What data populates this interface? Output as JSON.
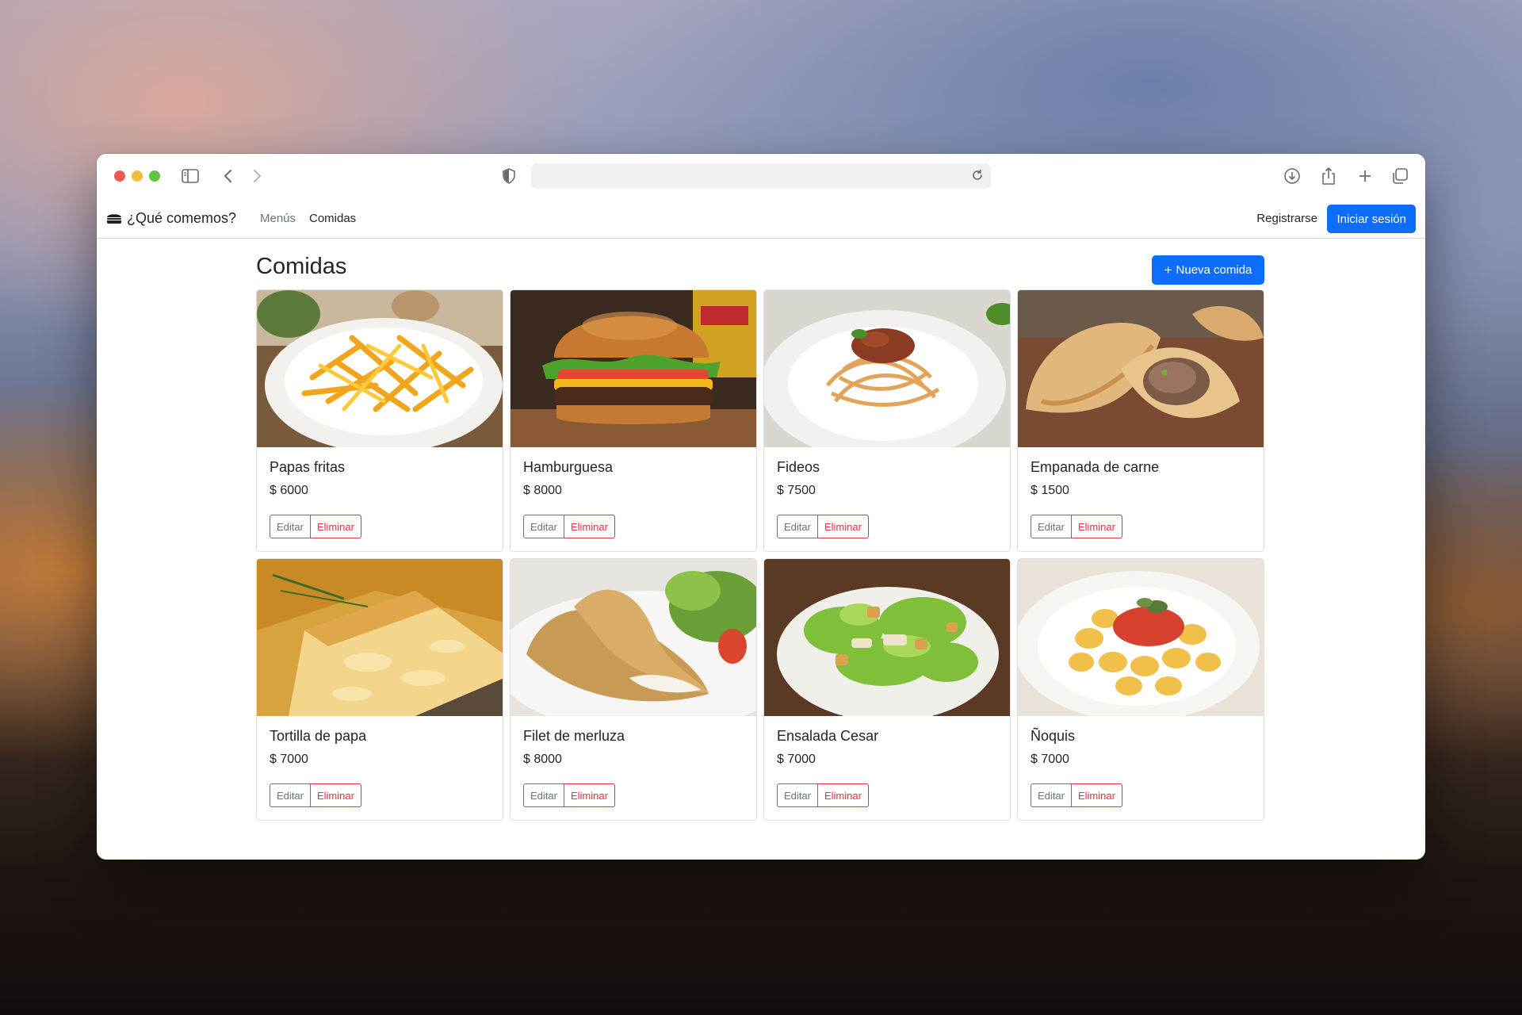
{
  "app": {
    "brand": "¿Qué comemos?",
    "nav": {
      "menus": "Menús",
      "comidas": "Comidas"
    },
    "register": "Registrarse",
    "login": "Iniciar sesión"
  },
  "page": {
    "title": "Comidas",
    "new_button": "Nueva comida"
  },
  "buttons": {
    "edit": "Editar",
    "delete": "Eliminar"
  },
  "foods": [
    {
      "name": "Papas fritas",
      "price": "$ 6000",
      "image": "french-fries-photo"
    },
    {
      "name": "Hamburguesa",
      "price": "$ 8000",
      "image": "hamburger-photo"
    },
    {
      "name": "Fideos",
      "price": "$ 7500",
      "image": "pasta-photo"
    },
    {
      "name": "Empanada de carne",
      "price": "$ 1500",
      "image": "empanada-photo"
    },
    {
      "name": "Tortilla de papa",
      "price": "$ 7000",
      "image": "tortilla-photo"
    },
    {
      "name": "Filet de merluza",
      "price": "$ 8000",
      "image": "fish-fillet-photo"
    },
    {
      "name": "Ensalada Cesar",
      "price": "$ 7000",
      "image": "caesar-salad-photo"
    },
    {
      "name": "Ñoquis",
      "price": "$ 7000",
      "image": "gnocchi-photo"
    }
  ],
  "colors": {
    "primary": "#0d6efd",
    "danger": "#dc3545",
    "secondary": "#6c757d"
  }
}
